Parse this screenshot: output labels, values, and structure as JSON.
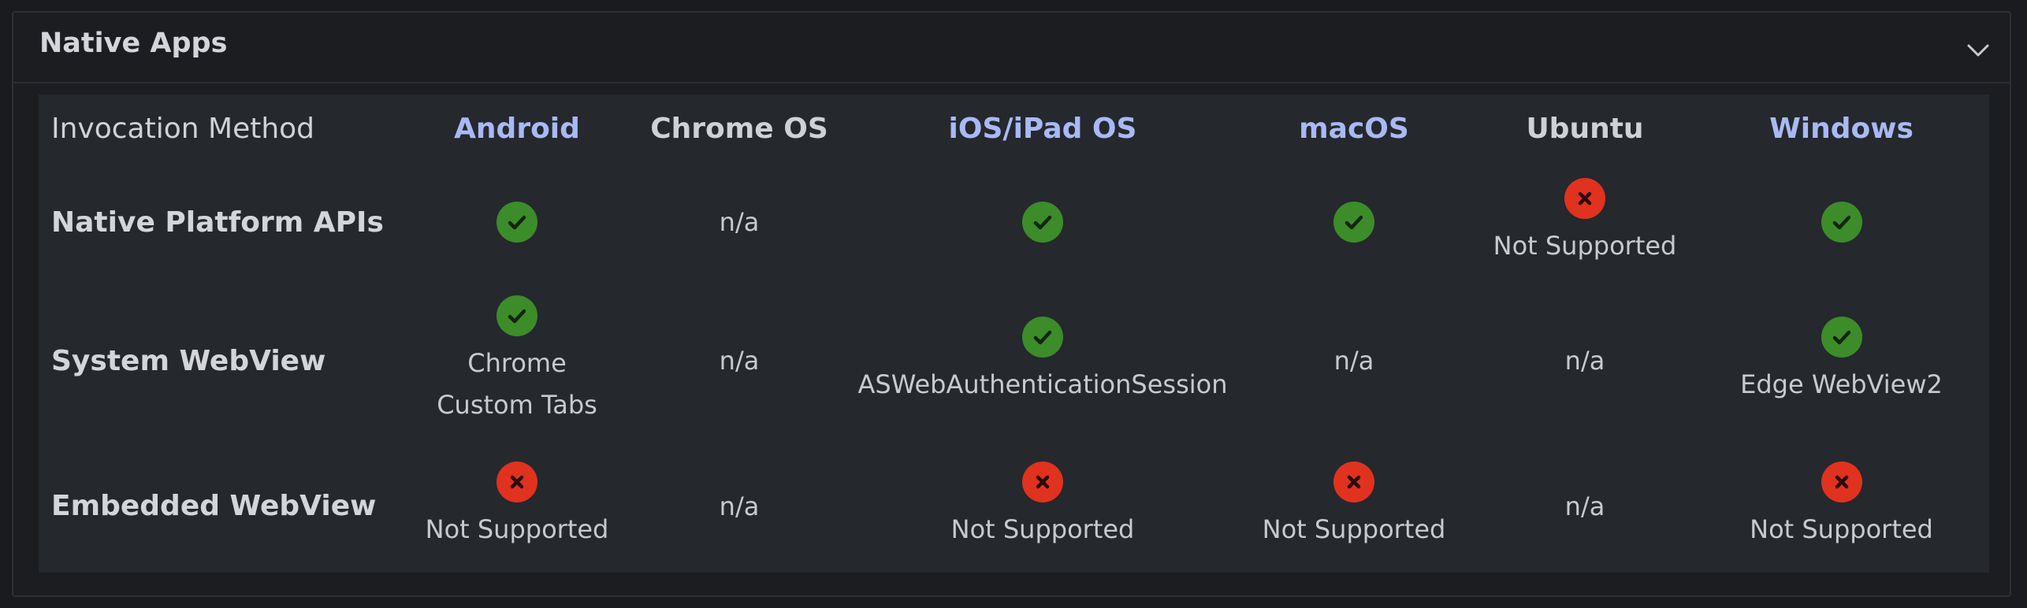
{
  "panel": {
    "title": "Native Apps",
    "toggle_icon": "chevron-down-icon"
  },
  "table": {
    "corner_label": "Invocation Method",
    "columns": [
      {
        "label": "Android",
        "link": true
      },
      {
        "label": "Chrome OS",
        "link": false
      },
      {
        "label": "iOS/iPad OS",
        "link": true
      },
      {
        "label": "macOS",
        "link": true
      },
      {
        "label": "Ubuntu",
        "link": false
      },
      {
        "label": "Windows",
        "link": true
      }
    ],
    "rows": [
      {
        "label": "Native Platform APIs",
        "cells": [
          {
            "status": "supported",
            "icon": "check-icon",
            "note": ""
          },
          {
            "status": "na",
            "text": "n/a"
          },
          {
            "status": "supported",
            "icon": "check-icon",
            "note": ""
          },
          {
            "status": "supported",
            "icon": "check-icon",
            "note": ""
          },
          {
            "status": "unsupported",
            "icon": "x-icon",
            "note": "Not Supported"
          },
          {
            "status": "supported",
            "icon": "check-icon",
            "note": ""
          }
        ]
      },
      {
        "label": "System WebView",
        "cells": [
          {
            "status": "supported",
            "icon": "check-icon",
            "note": "Chrome Custom Tabs",
            "note_lines": [
              "Chrome",
              "Custom Tabs"
            ]
          },
          {
            "status": "na",
            "text": "n/a"
          },
          {
            "status": "supported",
            "icon": "check-icon",
            "note": "ASWebAuthenticationSession"
          },
          {
            "status": "na",
            "text": "n/a"
          },
          {
            "status": "na",
            "text": "n/a"
          },
          {
            "status": "supported",
            "icon": "check-icon",
            "note": "Edge WebView2"
          }
        ]
      },
      {
        "label": "Embedded WebView",
        "cells": [
          {
            "status": "unsupported",
            "icon": "x-icon",
            "note": "Not Supported"
          },
          {
            "status": "na",
            "text": "n/a"
          },
          {
            "status": "unsupported",
            "icon": "x-icon",
            "note": "Not Supported"
          },
          {
            "status": "unsupported",
            "icon": "x-icon",
            "note": "Not Supported"
          },
          {
            "status": "na",
            "text": "n/a"
          },
          {
            "status": "unsupported",
            "icon": "x-icon",
            "note": "Not Supported"
          }
        ]
      }
    ]
  },
  "colors": {
    "background": "#191b1f",
    "table_background": "#25282d",
    "link": "#a9b9f5",
    "supported": "#3c8c2a",
    "unsupported": "#e0321f"
  }
}
